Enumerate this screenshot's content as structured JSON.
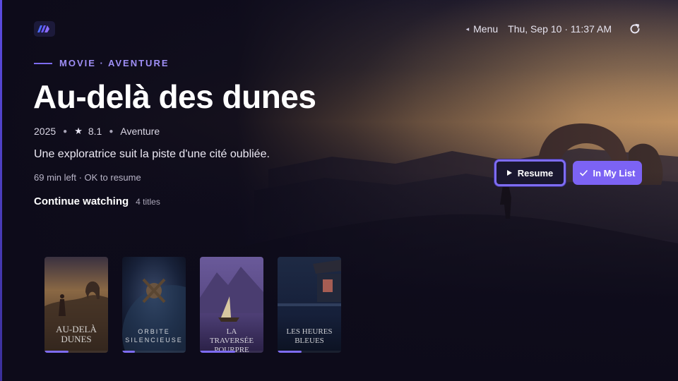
{
  "topbar": {
    "menu_label": "Menu",
    "datetime": "Thu, Sep 10 · 11:37 AM"
  },
  "hero": {
    "kicker": "MOVIE · AVENTURE",
    "title": "Au-delà des dunes",
    "year": "2025",
    "rating": "8.1",
    "genre": "Aventure",
    "description": "Une exploratrice suit la piste d'une cité oubliée.",
    "progress_text": "69 min left · OK to resume"
  },
  "actions": {
    "resume_label": "Resume",
    "my_list_label": "In My List"
  },
  "row": {
    "title": "Continue watching",
    "count": "4 titles"
  },
  "cards": [
    {
      "title": "AU-DELÀ DUNES",
      "progress": 0.38
    },
    {
      "title": "ORBITE SILENCIEUSE",
      "progress": 0.2
    },
    {
      "title": "LA TRAVERSÉE POURPRE",
      "progress": 0.55
    },
    {
      "title": "LES HEURES BLEUES",
      "progress": 0.38
    }
  ],
  "colors": {
    "accent": "#7c63f4",
    "background": "#0d0b1a"
  }
}
